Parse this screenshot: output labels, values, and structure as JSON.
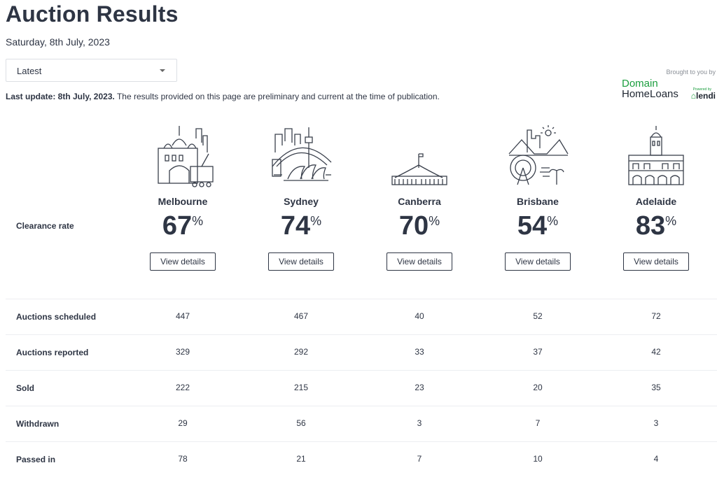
{
  "page": {
    "title": "Auction Results",
    "date": "Saturday, 8th July, 2023",
    "selector": {
      "value": "Latest"
    },
    "last_update_bold": "Last update: 8th July, 2023.",
    "last_update_text": " The results provided on this page are preliminary and current at the time of publication."
  },
  "sponsor": {
    "brought_by": "Brought to you by",
    "brand_line1": "Domain",
    "brand_line2": "HomeLoans",
    "powered_by": "Powered by",
    "partner": "lendi"
  },
  "clearance_label": "Clearance rate",
  "view_details_label": "View details",
  "percent_symbol": "%",
  "cities": [
    {
      "name": "Melbourne",
      "clearance_rate": "67",
      "icon": "melbourne-skyline-icon"
    },
    {
      "name": "Sydney",
      "clearance_rate": "74",
      "icon": "sydney-skyline-icon"
    },
    {
      "name": "Canberra",
      "clearance_rate": "70",
      "icon": "canberra-parliament-icon"
    },
    {
      "name": "Brisbane",
      "clearance_rate": "54",
      "icon": "brisbane-skyline-icon"
    },
    {
      "name": "Adelaide",
      "clearance_rate": "83",
      "icon": "adelaide-town-hall-icon"
    }
  ],
  "table": {
    "rows": [
      {
        "label": "Auctions scheduled",
        "values": [
          "447",
          "467",
          "40",
          "52",
          "72"
        ]
      },
      {
        "label": "Auctions reported",
        "values": [
          "329",
          "292",
          "33",
          "37",
          "42"
        ]
      },
      {
        "label": "Sold",
        "values": [
          "222",
          "215",
          "23",
          "20",
          "35"
        ]
      },
      {
        "label": "Withdrawn",
        "values": [
          "29",
          "56",
          "3",
          "7",
          "3"
        ]
      },
      {
        "label": "Passed in",
        "values": [
          "78",
          "21",
          "7",
          "10",
          "4"
        ]
      }
    ]
  }
}
